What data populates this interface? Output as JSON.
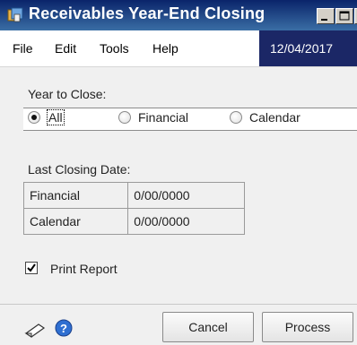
{
  "window": {
    "title": "Receivables Year-End Closing"
  },
  "menu": {
    "items": [
      "File",
      "Edit",
      "Tools",
      "Help"
    ],
    "date": "12/04/2017"
  },
  "year_to_close": {
    "label": "Year to Close:",
    "options": [
      "All",
      "Financial",
      "Calendar"
    ],
    "selected": "All"
  },
  "last_closing": {
    "label": "Last Closing Date:",
    "rows": [
      {
        "name": "Financial",
        "value": "0/00/0000"
      },
      {
        "name": "Calendar",
        "value": "0/00/0000"
      }
    ]
  },
  "print_report": {
    "label": "Print Report",
    "checked": true
  },
  "buttons": {
    "cancel": "Cancel",
    "process": "Process"
  },
  "colors": {
    "titlebar": "#0a246a",
    "date_bg": "#1b2766",
    "window_bg": "#f0f0f0"
  },
  "icons": [
    "app-icon",
    "minimize-icon",
    "maximize-icon",
    "close-icon",
    "note-icon",
    "help-icon",
    "checkmark-icon"
  ]
}
